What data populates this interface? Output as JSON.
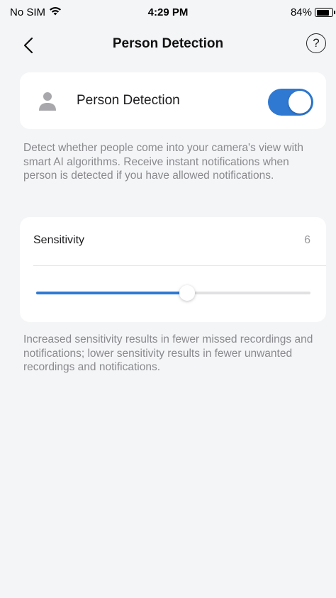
{
  "status_bar": {
    "carrier": "No SIM",
    "time": "4:29 PM",
    "battery_text": "84%"
  },
  "nav": {
    "title": "Person Detection",
    "help_glyph": "?"
  },
  "person_detection": {
    "label": "Person Detection",
    "enabled": true,
    "description": "Detect whether people come into your camera's view with smart AI algorithms. Receive instant notifications when person is detected if you have allowed notifications."
  },
  "sensitivity": {
    "label": "Sensitivity",
    "value": "6",
    "level_fraction": 0.55,
    "description": "Increased sensitivity results in fewer missed recordings and notifications; lower sensitivity results in fewer unwanted recordings and notifications."
  },
  "colors": {
    "accent": "#2f79d2",
    "background": "#f4f5f7",
    "card": "#ffffff",
    "secondary_text": "#8a8a8e"
  },
  "icons": [
    "wifi-icon",
    "battery-icon",
    "chevron-left-icon",
    "help-icon",
    "person-icon"
  ]
}
